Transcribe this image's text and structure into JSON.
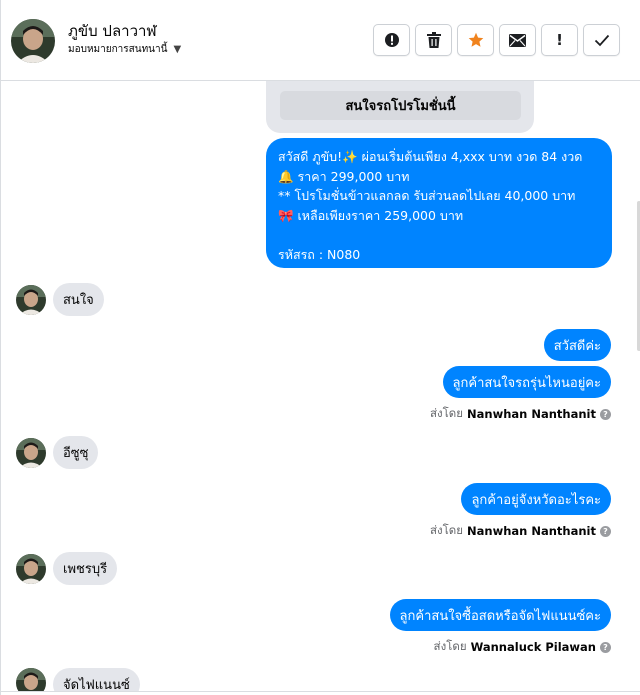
{
  "header": {
    "contact_name": "ภูขับ ปลาวาฬ",
    "assign_label": "มอบหมายการสนทนานี้",
    "actions": [
      {
        "name": "report-spam",
        "icon": "exclamation-circle-icon"
      },
      {
        "name": "delete",
        "icon": "trash-icon"
      },
      {
        "name": "star",
        "icon": "star-icon",
        "color": "#f0831e"
      },
      {
        "name": "mark-unread",
        "icon": "envelope-icon"
      },
      {
        "name": "follow-up",
        "label": "!"
      },
      {
        "name": "done",
        "icon": "checkmark-icon"
      }
    ]
  },
  "thread": {
    "card_button": "สนใจรถโปรโมชั่นนี้",
    "promo_message": {
      "lines": [
        "สวัสดี ภูขับ!✨  ผ่อนเริ่มต้นเพียง 4,xxx บาท งวด 84 งวด",
        "🔔 ราคา 299,000 บาท",
        "** โปรโมชั่นข้าวแลกลด รับส่วนลดไปเลย 40,000 บาท",
        "🎀  เหลือเพียงราคา 259,000 บาท",
        "",
        "รหัสรถ : N080"
      ]
    },
    "messages": [
      {
        "dir": "in",
        "text": "สนใจ"
      },
      {
        "dir": "out",
        "text": "สวัสดีค่ะ"
      },
      {
        "dir": "out",
        "text": "ลูกค้าสนใจรถรุ่นไหนอยู่คะ"
      },
      {
        "dir": "sent_by",
        "prefix": "ส่งโดย",
        "agent": "Nanwhan Nanthanit"
      },
      {
        "dir": "in",
        "text": "อีซูซุ"
      },
      {
        "dir": "out",
        "text": "ลูกค้าอยู่จังหวัดอะไรคะ"
      },
      {
        "dir": "sent_by",
        "prefix": "ส่งโดย",
        "agent": "Nanwhan Nanthanit"
      },
      {
        "dir": "in",
        "text": "เพชรบุรี"
      },
      {
        "dir": "out",
        "text": "ลูกค้าสนใจซื้อสดหรือจัดไฟแนนซ์คะ"
      },
      {
        "dir": "sent_by",
        "prefix": "ส่งโดย",
        "agent": "Wannaluck Pilawan"
      },
      {
        "dir": "in",
        "text": "จัดไฟแนนซ์"
      }
    ]
  },
  "colors": {
    "outgoing_bubble": "#0084ff",
    "incoming_bubble": "#e4e6eb",
    "star": "#f0831e"
  }
}
